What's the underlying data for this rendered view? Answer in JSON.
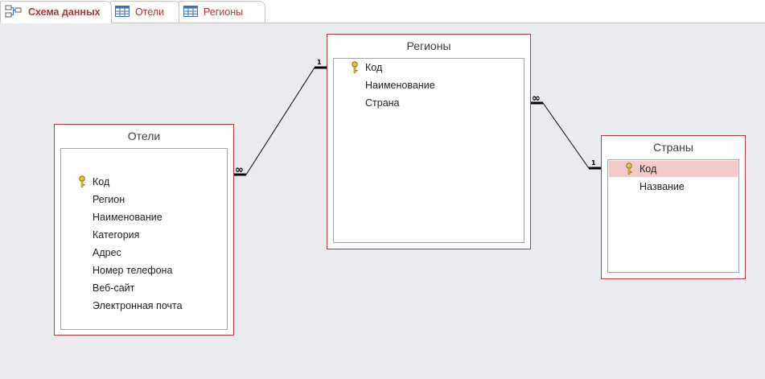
{
  "tabs": [
    {
      "label": "Схема данных",
      "icon": "relationships-icon",
      "active": true
    },
    {
      "label": "Отели",
      "icon": "table-icon",
      "active": false
    },
    {
      "label": "Регионы",
      "icon": "table-icon",
      "active": false
    }
  ],
  "tables": {
    "hotels": {
      "title": "Отели",
      "fields": [
        "Код",
        "Регион",
        "Наименование",
        "Категория",
        "Адрес",
        "Номер телефона",
        "Веб-сайт",
        "Электронная почта"
      ],
      "primary_key": "Код"
    },
    "regions": {
      "title": "Регионы",
      "fields": [
        "Код",
        "Наименование",
        "Страна"
      ],
      "primary_key": "Код"
    },
    "countries": {
      "title": "Страны",
      "fields": [
        "Код",
        "Название"
      ],
      "primary_key": "Код",
      "selected_field": "Код"
    }
  },
  "relationships": [
    {
      "one_side": "1",
      "many_side": "∞",
      "from": "regions",
      "to": "hotels"
    },
    {
      "one_side": "1",
      "many_side": "∞",
      "from": "countries",
      "to": "regions"
    }
  ],
  "colors": {
    "accent": "#a4373a",
    "table_border": "#a63b40",
    "selection": "#f6c9cb",
    "canvas": "#e9ebee"
  }
}
